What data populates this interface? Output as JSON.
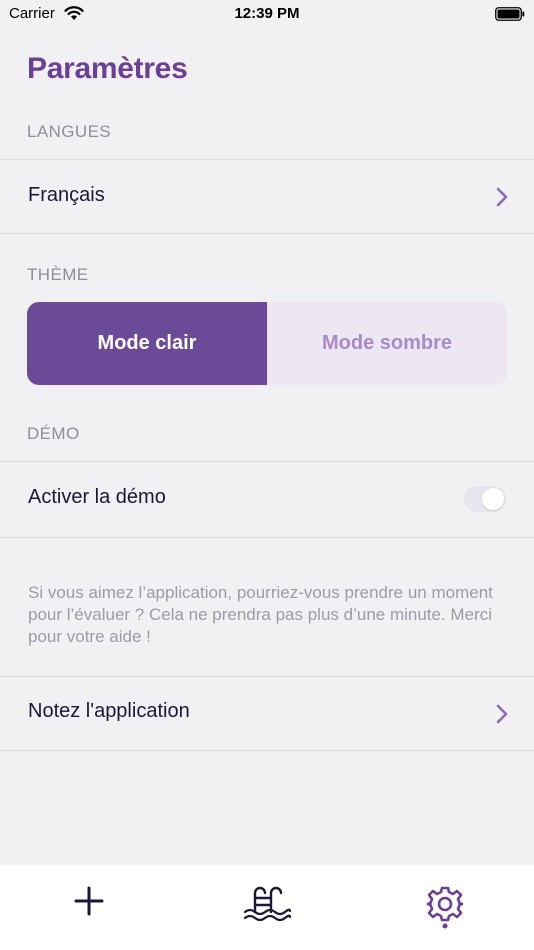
{
  "status_bar": {
    "carrier": "Carrier",
    "time": "12:39 PM",
    "wifi_icon": "wifi-icon",
    "battery_icon": "battery-icon"
  },
  "page": {
    "title": "Paramètres"
  },
  "sections": {
    "languages": {
      "header": "LANGUES",
      "row_label": "Français"
    },
    "theme": {
      "header": "THÈME",
      "options": [
        "Mode clair",
        "Mode sombre"
      ],
      "selected": "Mode clair"
    },
    "demo": {
      "header": "DÉMO",
      "row_label": "Activer la démo",
      "toggle_on": false
    },
    "rating": {
      "note": "Si vous aimez l’application, pourriez-vous prendre un moment pour l’évaluer ? Cela ne prendra pas plus d’une minute. Merci pour votre aide !",
      "row_label": "Notez l'application"
    }
  },
  "tab_bar": {
    "tabs": [
      {
        "icon": "plus-icon",
        "active": false
      },
      {
        "icon": "pool-icon",
        "active": false
      },
      {
        "icon": "gear-icon",
        "active": true
      }
    ]
  },
  "colors": {
    "accent": "#6b3e97",
    "background": "#f1f1f4",
    "segment_active": "#6b4a98",
    "segment_inactive_text": "#a98ac9",
    "chevron": "#8a6cb5",
    "tab_icon": "#1d1638"
  }
}
